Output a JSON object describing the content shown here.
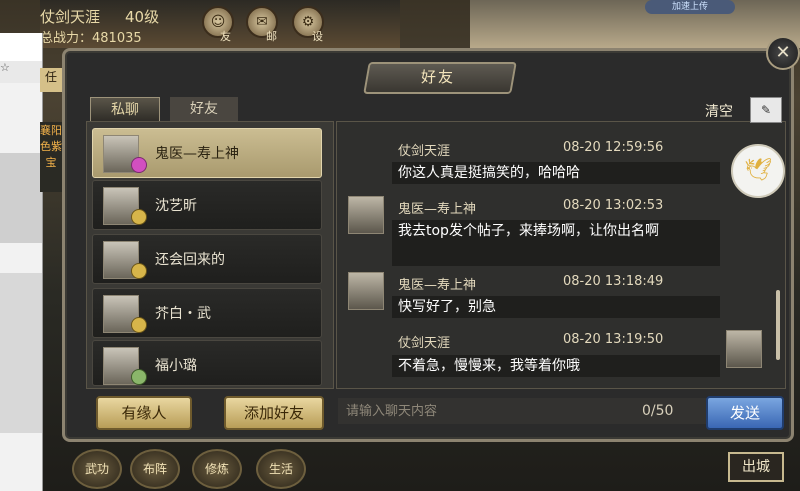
{
  "hud": {
    "player_name": "仗剑天涯",
    "level": "40级",
    "power": "总战力：481035",
    "icon_mail_label": "邮",
    "icon_settings_label": "设",
    "icon_friend_label": "友",
    "pill_text": "加速上传"
  },
  "dialog": {
    "title": "好友",
    "tabs": [
      "私聊",
      "好友"
    ],
    "clear_label": "清空"
  },
  "friends": [
    {
      "name": "鬼医—寿上神",
      "selected": true,
      "badge": "pink"
    },
    {
      "name": "沈艺昕",
      "selected": false,
      "badge": "gold"
    },
    {
      "name": "还会回来的",
      "selected": false,
      "badge": "gold"
    },
    {
      "name": "芥白・武",
      "selected": false,
      "badge": "gold"
    },
    {
      "name": "福小璐",
      "selected": false,
      "badge": "green"
    }
  ],
  "messages": [
    {
      "sender": "仗剑天涯",
      "time": "08-20 12:59:56",
      "text": "你这人真是挺搞笑的，哈哈哈",
      "side": "right"
    },
    {
      "sender": "鬼医—寿上神",
      "time": "08-20 13:02:53",
      "text": "我去top发个帖子，来捧场啊，让你出名啊",
      "side": "left"
    },
    {
      "sender": "鬼医—寿上神",
      "time": "08-20 13:18:49",
      "text": "快写好了，别急",
      "side": "left"
    },
    {
      "sender": "仗剑天涯",
      "time": "08-20 13:19:50",
      "text": "不着急，慢慢来，我等着你哦",
      "side": "right"
    }
  ],
  "footer": {
    "btn_fate": "有缘人",
    "btn_add_friend": "添加好友",
    "input_placeholder": "请输入聊天内容",
    "counter": "0/50",
    "send": "发送"
  },
  "nav": {
    "items": [
      "武功",
      "布阵",
      "修炼",
      "生活"
    ],
    "exit": "出城"
  }
}
